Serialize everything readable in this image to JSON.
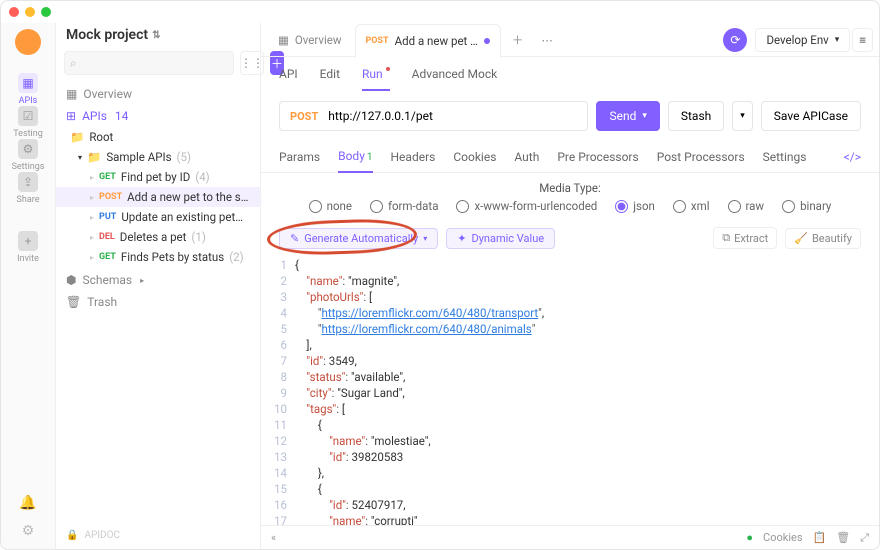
{
  "project": {
    "name": "Mock project"
  },
  "rail": {
    "items": [
      {
        "key": "apis",
        "label": "APIs",
        "glyph": "▦"
      },
      {
        "key": "testing",
        "label": "Testing",
        "glyph": "☑"
      },
      {
        "key": "settings",
        "label": "Settings",
        "glyph": "⚙"
      },
      {
        "key": "share",
        "label": "Share",
        "glyph": "⇪"
      },
      {
        "key": "invite",
        "label": "Invite",
        "glyph": "+"
      }
    ]
  },
  "sidebar": {
    "search_placeholder": "",
    "overview": "Overview",
    "apis_label": "APIs",
    "apis_count": "14",
    "root_label": "Root",
    "folder_label": "Sample APIs",
    "folder_count": "(5)",
    "endpoints": [
      {
        "method": "GET",
        "mclass": "m-get",
        "name": "Find pet by ID",
        "count": "(4)"
      },
      {
        "method": "POST",
        "mclass": "m-post",
        "name": "Add a new pet to the s…",
        "count": ""
      },
      {
        "method": "PUT",
        "mclass": "m-put",
        "name": "Update an existing pet…",
        "count": ""
      },
      {
        "method": "DEL",
        "mclass": "m-del",
        "name": "Deletes a pet",
        "count": "(1)"
      },
      {
        "method": "GET",
        "mclass": "m-get",
        "name": "Finds Pets by status",
        "count": "(2)"
      }
    ],
    "schemas_label": "Schemas",
    "trash_label": "Trash",
    "footer_brand": "APIDOC"
  },
  "tabs": {
    "overview": "Overview",
    "active_method": "POST",
    "active_title": "Add a new pet …"
  },
  "topright": {
    "env_label": "Develop Env"
  },
  "subtabs": {
    "api": "API",
    "edit": "Edit",
    "run": "Run",
    "advanced": "Advanced Mock"
  },
  "url": {
    "method": "POST",
    "value": "http://127.0.0.1/pet"
  },
  "actions": {
    "send": "Send",
    "stash": "Stash",
    "save": "Save APICase"
  },
  "reqtabs": {
    "params": "Params",
    "body": "Body",
    "body_badge": "1",
    "headers": "Headers",
    "cookies": "Cookies",
    "auth": "Auth",
    "pre": "Pre Processors",
    "post": "Post Processors",
    "settings": "Settings"
  },
  "body": {
    "media_label": "Media Type:",
    "options": [
      "none",
      "form-data",
      "x-www-form-urlencoded",
      "json",
      "xml",
      "raw",
      "binary"
    ],
    "selected": "json",
    "generate": "Generate Automatically",
    "dynamic": "Dynamic Value",
    "extract": "Extract",
    "beautify": "Beautify"
  },
  "json_body": {
    "name": "magnite",
    "photoUrls": [
      "https://loremflickr.com/640/480/transport",
      "https://loremflickr.com/640/480/animals"
    ],
    "id": 3549,
    "status": "available",
    "city": "Sugar Land",
    "tags": [
      {
        "name": "molestiae",
        "id": 39820583
      },
      {
        "id": 52407917,
        "name": "corrupti"
      }
    ]
  },
  "editor_lines": [
    "{",
    "    \"name\": \"magnite\",",
    "    \"photoUrls\": [",
    "        \"https://loremflickr.com/640/480/transport\",",
    "        \"https://loremflickr.com/640/480/animals\"",
    "    ],",
    "    \"id\": 3549,",
    "    \"status\": \"available\",",
    "    \"city\": \"Sugar Land\",",
    "    \"tags\": [",
    "        {",
    "            \"name\": \"molestiae\",",
    "            \"id\": 39820583",
    "        },",
    "        {",
    "            \"id\": 52407917,",
    "            \"name\": \"corrupti\"",
    "        }"
  ],
  "statusbar": {
    "cookies": "Cookies"
  }
}
